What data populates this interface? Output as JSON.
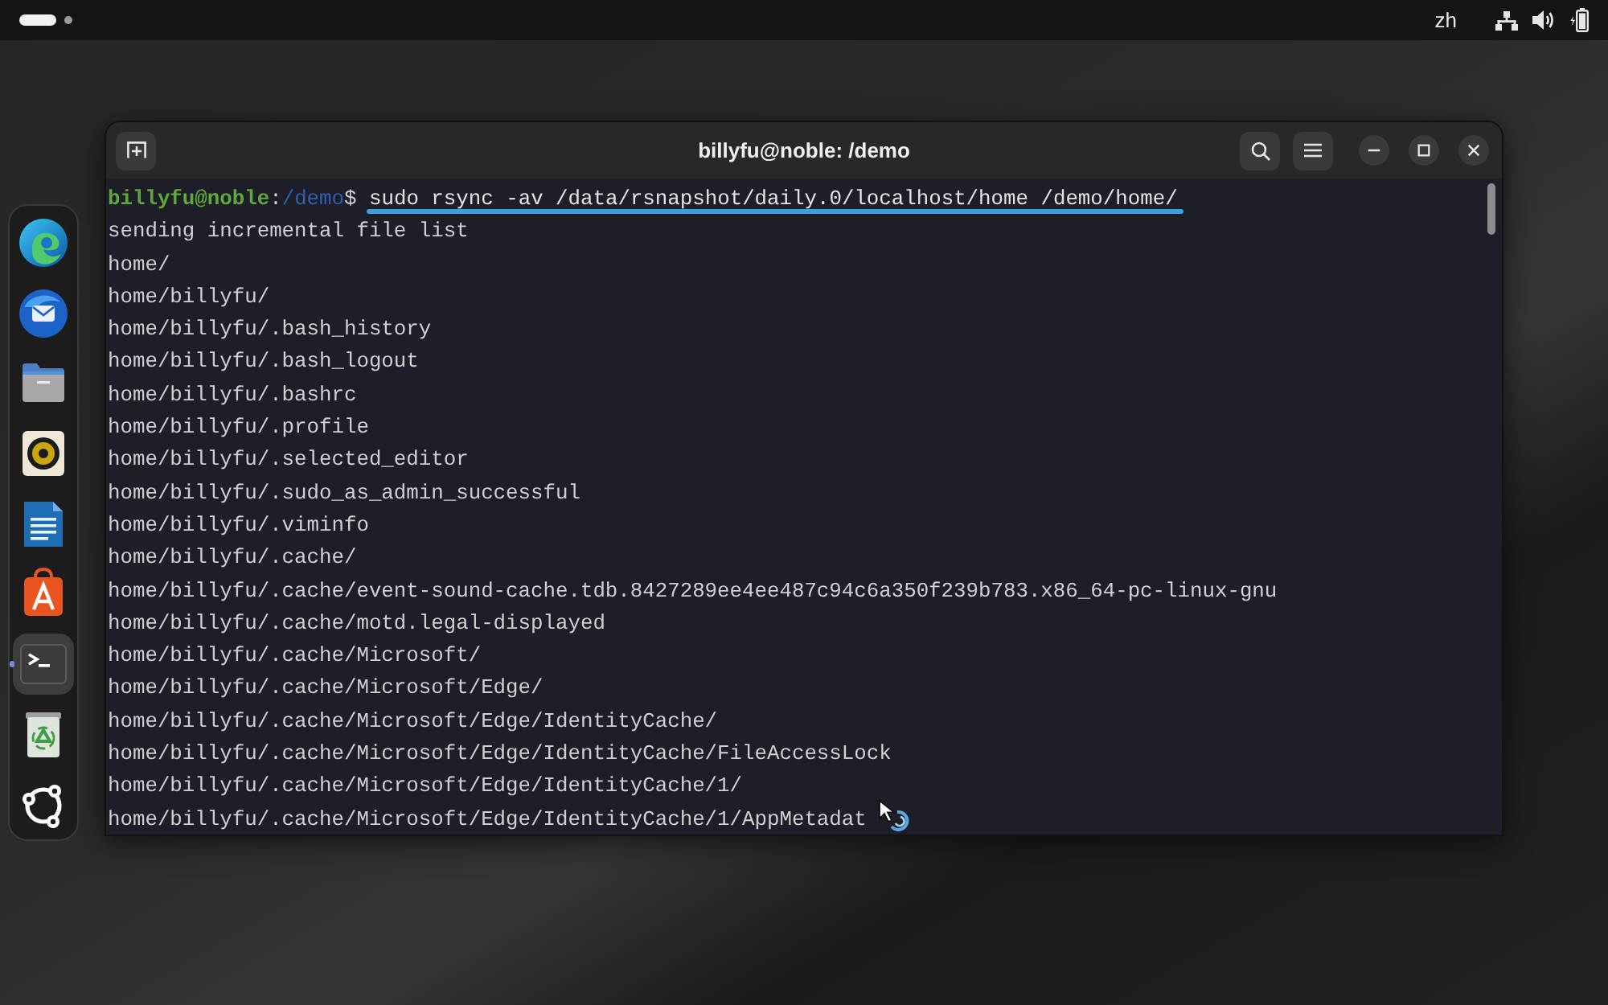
{
  "top_bar": {
    "input_source": "zh"
  },
  "dock": {
    "items": [
      {
        "selected": false,
        "running": false
      },
      {
        "selected": false,
        "running": false
      },
      {
        "selected": false,
        "running": false
      },
      {
        "selected": false,
        "running": false
      },
      {
        "selected": false,
        "running": false
      },
      {
        "selected": false,
        "running": false
      },
      {
        "selected": true,
        "running": true
      },
      {
        "selected": false,
        "running": false
      },
      {
        "selected": false,
        "running": false
      }
    ]
  },
  "window": {
    "title": "billyfu@noble: /demo"
  },
  "terminal": {
    "prompt": {
      "user_host": "billyfu@noble",
      "separator": ":",
      "path": "/demo",
      "symbol": "$"
    },
    "command": "sudo rsync -av /data/rsnapshot/daily.0/localhost/home /demo/home/",
    "command_underlined": true,
    "output": [
      "sending incremental file list",
      "home/",
      "home/billyfu/",
      "home/billyfu/.bash_history",
      "home/billyfu/.bash_logout",
      "home/billyfu/.bashrc",
      "home/billyfu/.profile",
      "home/billyfu/.selected_editor",
      "home/billyfu/.sudo_as_admin_successful",
      "home/billyfu/.viminfo",
      "home/billyfu/.cache/",
      "home/billyfu/.cache/event-sound-cache.tdb.8427289ee4ee487c94c6a350f239b783.x86_64-pc-linux-gnu",
      "home/billyfu/.cache/motd.legal-displayed",
      "home/billyfu/.cache/Microsoft/",
      "home/billyfu/.cache/Microsoft/Edge/",
      "home/billyfu/.cache/Microsoft/Edge/IdentityCache/",
      "home/billyfu/.cache/Microsoft/Edge/IdentityCache/FileAccessLock",
      "home/billyfu/.cache/Microsoft/Edge/IdentityCache/1/",
      "home/billyfu/.cache/Microsoft/Edge/IdentityCache/1/AppMetadat"
    ]
  }
}
